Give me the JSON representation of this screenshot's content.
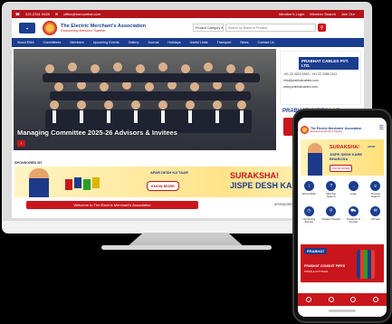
{
  "topbar": {
    "phone": "022-2341 0625",
    "email": "office@eamumbai.com",
    "links": [
      "Member's Login",
      "Member Search",
      "Join Our"
    ]
  },
  "header": {
    "title": "The Electric Merchant's Association",
    "tagline": "Empowering Members Together",
    "category_select": "Product Category",
    "search_placeholder": "Search by Brand or Product"
  },
  "nav": [
    "About EMA",
    "Committees",
    "Members",
    "Upcoming Events",
    "Gallery",
    "Journal",
    "Holidays",
    "Useful Links",
    "Transport",
    "News",
    "Contact Us"
  ],
  "hero": {
    "caption": "Managing Committee 2025-26 Advisors & Invitees"
  },
  "side_ad1": {
    "company": "PRABHAT CABLES PVT. LTD.",
    "phone": "+91 22 4022 9292 / +91 22 2389 2111",
    "email": "info@prabhatcables.com",
    "web": "www.prabhatcables.com"
  },
  "side_ad2": {
    "company": "PRABHAT WIRES LLP"
  },
  "sponsored": {
    "label": "SPONSORED BY",
    "apar": "APAR DESH KA TAAR",
    "button": "KNOW MORE",
    "slogan1": "SURAKSHA!",
    "slogan2": "JISPE DESH KARE BHAROSA"
  },
  "welcome": "Welcome to The Electric Merchant's Association",
  "sponsored_by_right": "SPONSORED BY",
  "phone": {
    "title": "The Electric Merchants' Association",
    "tagline": "Empowering Members Together",
    "banner_s1": "SURAKSHA!",
    "banner_s2": "JISPE DESH KARE",
    "banner_s3": "BHAROSA",
    "banner_btn": "KNOW MORE",
    "banner_apar": "APAR",
    "grid": [
      {
        "label": "About EMA",
        "icon": "i"
      },
      {
        "label": "Member\nSearch",
        "icon": "?"
      },
      {
        "label": "Login",
        "icon": "→"
      },
      {
        "label": "Product\nSearch",
        "icon": "≡"
      },
      {
        "label": "Upcoming\nEvents",
        "icon": "◷"
      },
      {
        "label": "Dealers Search",
        "icon": "⚲"
      },
      {
        "label": "Transport &\nCourier",
        "icon": "⛟"
      },
      {
        "label": "Circular",
        "icon": "✉"
      }
    ],
    "prabhat_logo": "PRABHAT",
    "prabhat_t1": "PRABHAT CONDUIT PIPES",
    "prabhat_t2": "PIPES & FITTINGS"
  }
}
